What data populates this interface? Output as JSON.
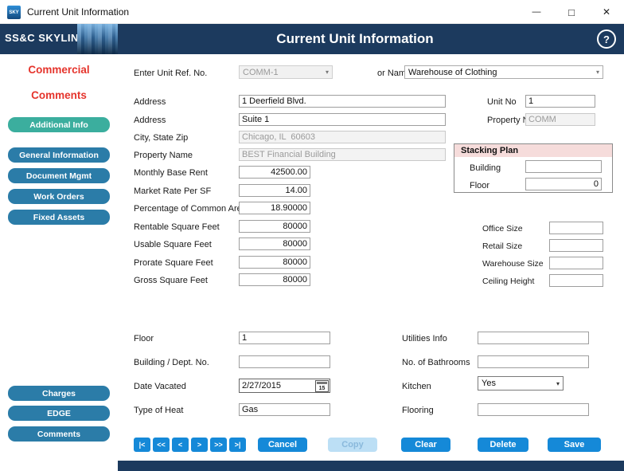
{
  "window": {
    "title": "Current Unit Information",
    "app_icon_text": "SKY",
    "minimize_icon": "—",
    "maximize_icon": "□",
    "close_icon": "✕"
  },
  "header": {
    "brand": "SS&C SKYLINE",
    "brand_reg": "®",
    "title": "Current Unit Information",
    "help_icon": "?"
  },
  "icons": {
    "chevron": "▾"
  },
  "sidebar": {
    "headings": [
      {
        "label": "Commercial"
      },
      {
        "label": "Comments"
      }
    ],
    "nav": [
      {
        "label": "Additional Info"
      },
      {
        "label": "General Information"
      },
      {
        "label": "Document Mgmt"
      },
      {
        "label": "Work Orders"
      },
      {
        "label": "Fixed Assets"
      }
    ],
    "bottom": [
      {
        "label": "Charges"
      },
      {
        "label": "EDGE"
      },
      {
        "label": "Comments"
      }
    ]
  },
  "form": {
    "unit_ref": {
      "label": "Enter Unit Ref. No.",
      "value": "COMM-1"
    },
    "or_name": {
      "label": "or Name",
      "value": "Warehouse of Clothing"
    },
    "address1": {
      "label": "Address",
      "value": "1 Deerfield Blvd."
    },
    "address2": {
      "label": "Address",
      "value": "Suite 1"
    },
    "city_state_zip": {
      "label": "City, State Zip",
      "value": "Chicago, IL  60603"
    },
    "property_name": {
      "label": "Property Name",
      "value": "BEST Financial Building"
    },
    "monthly_base_rent": {
      "label": "Monthly Base Rent",
      "value": "42500.00"
    },
    "market_rate_per_sf": {
      "label": "Market Rate Per SF",
      "value": "14.00"
    },
    "pct_common_area": {
      "label": "Percentage of Common Area",
      "value": "18.90000"
    },
    "rentable_sqft": {
      "label": "Rentable Square Feet",
      "value": "80000"
    },
    "usable_sqft": {
      "label": "Usable Square Feet",
      "value": "80000"
    },
    "prorate_sqft": {
      "label": "Prorate Square Feet",
      "value": "80000"
    },
    "gross_sqft": {
      "label": "Gross Square Feet",
      "value": "80000"
    },
    "unit_no": {
      "label": "Unit No",
      "value": "1"
    },
    "property_no": {
      "label": "Property No.",
      "value": "COMM"
    },
    "stacking_plan": {
      "title": "Stacking Plan",
      "building": {
        "label": "Building",
        "value": ""
      },
      "floor": {
        "label": "Floor",
        "value": "0"
      }
    },
    "office_size": {
      "label": "Office Size",
      "value": ""
    },
    "retail_size": {
      "label": "Retail Size",
      "value": ""
    },
    "warehouse_size": {
      "label": "Warehouse Size",
      "value": ""
    },
    "ceiling_height": {
      "label": "Ceiling Height",
      "value": ""
    },
    "floor": {
      "label": "Floor",
      "value": "1"
    },
    "building_dept_no": {
      "label": "Building / Dept. No.",
      "value": ""
    },
    "date_vacated": {
      "label": "Date Vacated",
      "value": "2/27/2015",
      "calendar_icon": "15"
    },
    "type_of_heat": {
      "label": "Type of Heat",
      "value": "Gas"
    },
    "utilities_info": {
      "label": "Utilities Info",
      "value": ""
    },
    "no_of_bathrooms": {
      "label": "No. of Bathrooms",
      "value": ""
    },
    "kitchen": {
      "label": "Kitchen",
      "value": "Yes"
    },
    "flooring": {
      "label": "Flooring",
      "value": ""
    }
  },
  "actions": {
    "nav": [
      "|<",
      "<<",
      "<",
      ">",
      ">>",
      ">|"
    ],
    "cancel": "Cancel",
    "copy": "Copy",
    "clear": "Clear",
    "delete": "Delete",
    "save": "Save"
  },
  "colors": {
    "header_navy": "#1c3a5e",
    "sidebar_button": "#2b7ca8",
    "sidebar_active": "#3bae9e",
    "accent_red": "#e5342c",
    "action_blue": "#1589d8",
    "action_disabled": "#bcdff5",
    "stacking_title_bg": "#f6dcdb"
  }
}
